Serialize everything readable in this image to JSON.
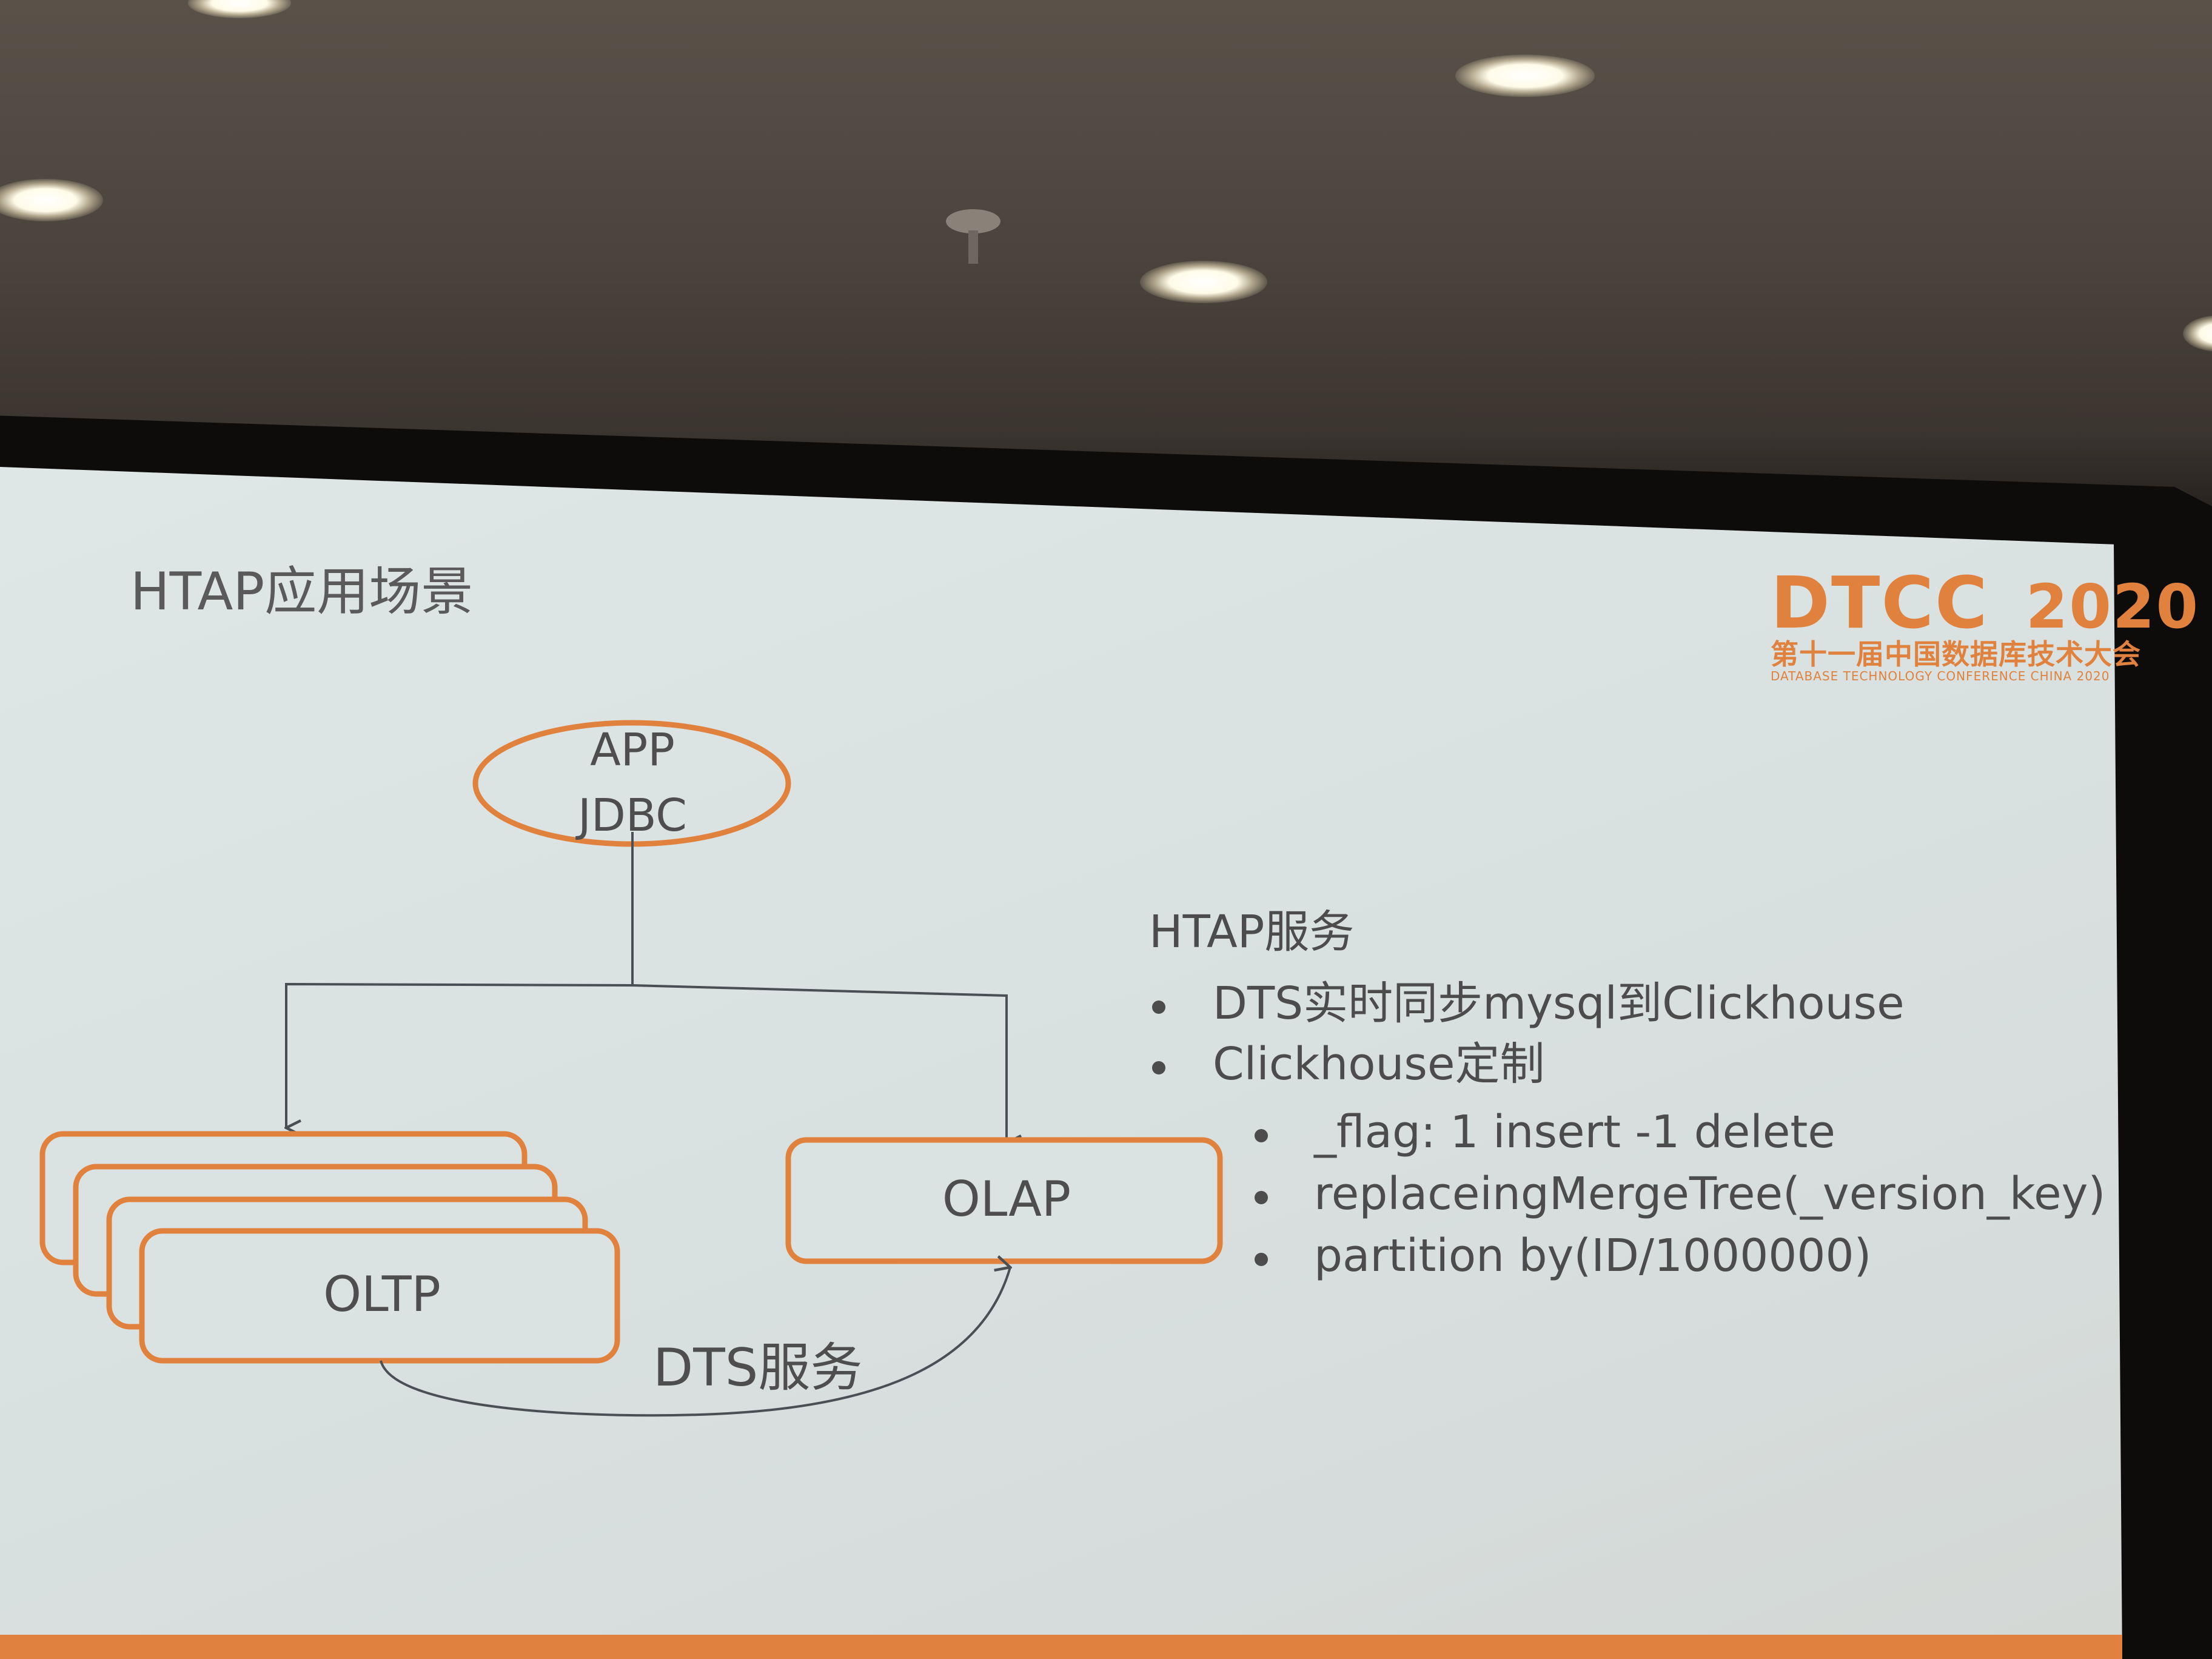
{
  "slide": {
    "title": "HTAP应用场景",
    "logo": {
      "brand": "DTCC",
      "year": "2020",
      "cn_name": "第十一届中国数据库技术大会",
      "en_name": "DATABASE TECHNOLOGY CONFERENCE CHINA 2020"
    }
  },
  "diagram": {
    "app_line1": "APP",
    "app_line2": "JDBC",
    "oltp_label": "OLTP",
    "olap_label": "OLAP",
    "dts_label": "DTS服务",
    "accent_color": "#e0823d"
  },
  "bullets": {
    "heading": "HTAP服务",
    "items": [
      "DTS实时同步mysql到Clickhouse",
      "Clickhouse定制"
    ],
    "sub_items": [
      "_flag: 1 insert -1 delete",
      "replaceingMergeTree(_version_key)",
      "partition by(ID/1000000)"
    ]
  }
}
